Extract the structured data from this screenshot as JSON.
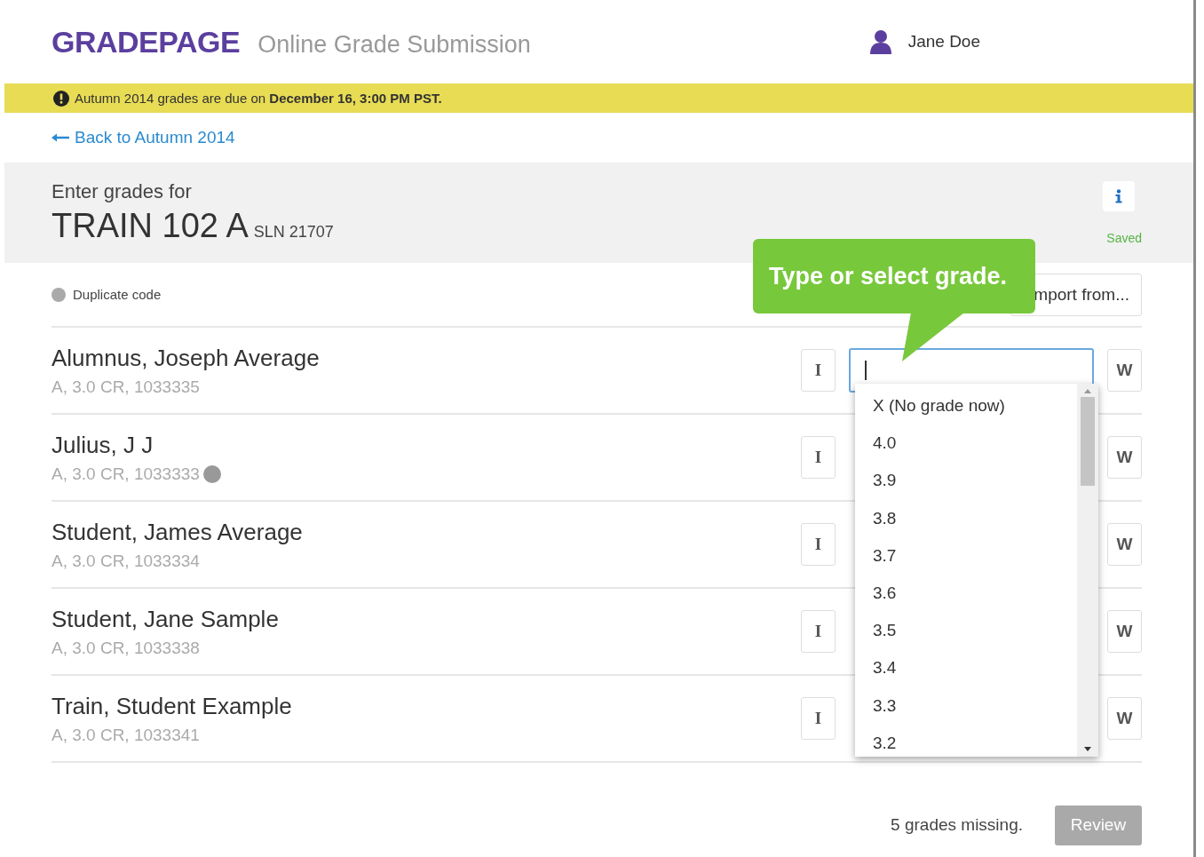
{
  "header": {
    "logo": "GRADEPAGE",
    "subtitle": "Online Grade Submission",
    "user": "Jane Doe"
  },
  "banner": {
    "text": "Autumn 2014 grades are due on **December 16, 3:00 PM PST.**"
  },
  "back_link": "Back to Autumn 2014",
  "course": {
    "prompt": "Enter grades for",
    "title": "TRAIN 102 A",
    "sln": "SLN 21707",
    "status": "Saved"
  },
  "legend": {
    "label": "Duplicate code"
  },
  "import_button": "mport from...",
  "tooltip": "Type or select grade.",
  "students": [
    {
      "name": "Alumnus, Joseph Average",
      "detail": "A, 3.0 CR, 1033335",
      "duplicate": false,
      "incomplete": "I",
      "writing": "W",
      "focused": true
    },
    {
      "name": "Julius, J J",
      "detail": "A, 3.0 CR, 1033333",
      "duplicate": true,
      "incomplete": "I",
      "writing": "W",
      "focused": false
    },
    {
      "name": "Student, James Average",
      "detail": "A, 3.0 CR, 1033334",
      "duplicate": false,
      "incomplete": "I",
      "writing": "W",
      "focused": false
    },
    {
      "name": "Student, Jane Sample",
      "detail": "A, 3.0 CR, 1033338",
      "duplicate": false,
      "incomplete": "I",
      "writing": "W",
      "focused": false
    },
    {
      "name": "Train, Student Example",
      "detail": "A, 3.0 CR, 1033341",
      "duplicate": false,
      "incomplete": "I",
      "writing": "W",
      "focused": false
    }
  ],
  "grade_options": [
    "X (No grade now)",
    "4.0",
    "3.9",
    "3.8",
    "3.7",
    "3.6",
    "3.5",
    "3.4",
    "3.3",
    "3.2"
  ],
  "footer": {
    "missing": "5 grades missing.",
    "review_button": "Review",
    "review_disabled": true
  }
}
